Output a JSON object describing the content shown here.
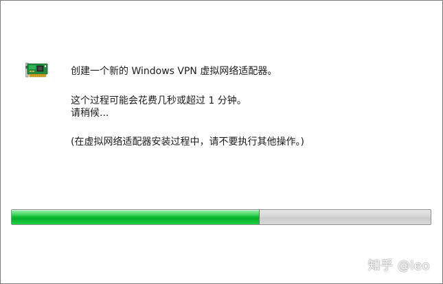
{
  "dialog": {
    "message_title": "创建一个新的 Windows VPN 虚拟网络适配器。",
    "message_process": "这个过程可能会花费几秒或超过 1 分钟。",
    "message_wait": "请稍候...",
    "message_note": "(在虚拟网络适配器安装过程中，请不要执行其他操作。)",
    "icon": "network-adapter-icon",
    "progress_fraction": 0.59,
    "colors": {
      "progress_fill": "#0ab82f",
      "progress_track": "#d6d6d6",
      "border": "#7a7a7a"
    }
  },
  "watermark": {
    "text": "知乎 @leo"
  }
}
